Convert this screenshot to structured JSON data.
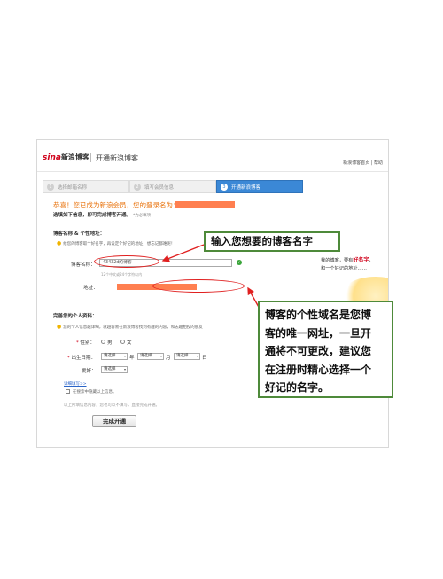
{
  "header": {
    "logo_brand": "sina",
    "logo_text": "新浪博客",
    "title": "开通新浪博客",
    "links": [
      "新浪博客首页",
      "帮助"
    ]
  },
  "steps": [
    {
      "num": "1",
      "label": "选择邮箱名称"
    },
    {
      "num": "2",
      "label": "填写会员信息"
    },
    {
      "num": "3",
      "label": "开通新浪博客"
    }
  ],
  "congrats": "恭喜！您已成为新浪会员，您的登录名为：",
  "instruction": "选填如下信息，即可完成博客开通。",
  "instruction_note": "*为必填项",
  "blog_section": {
    "heading": "博客名称 & 个性地址：",
    "hint": "给您的博客取个好名字，再设定个好记的地址，想忘记都难呢！",
    "name_label": "博客名称：",
    "name_value": "43432d的博客",
    "name_subhint": "12个中文或24个字符以内",
    "address_label": "地址："
  },
  "side_caption": {
    "line1_a": "我的博客，要有",
    "line1_b": "好名字",
    "line1_c": "，",
    "line2": "和一个好记的地址……"
  },
  "personal_section": {
    "heading": "完善您的个人资料：",
    "hint": "您的个人信息越详细，就越容易在新浪博客找到有趣的内容，和志趣相投的朋友",
    "gender_label": "性别：",
    "gender_options": [
      "男",
      "女"
    ],
    "birthday_label": "出生日期：",
    "select_placeholder": "请选择",
    "year_unit": "年",
    "month_unit": "月",
    "day_unit": "日",
    "hobby_label": "爱好：",
    "detail_link": "详细填写>>",
    "search_checkbox_label": "在搜索中隐藏以上信息。",
    "footnote": "以上所填信息内容，您也可以不填写，直接完成开通。"
  },
  "submit_label": "完成开通",
  "callouts": {
    "enter_name": "输入您想要的博客名字",
    "domain_lines": [
      "博客的个性域名是您博",
      "客的唯一网址，一旦开",
      "通将不可更改，建议您",
      "在注册时精心选择一个",
      "好记的名字。"
    ]
  },
  "colors": {
    "accent_blue": "#3b88d6",
    "redaction": "#ff7f50",
    "callout_border": "#4e8a3a",
    "annotation_red": "#e02020"
  }
}
